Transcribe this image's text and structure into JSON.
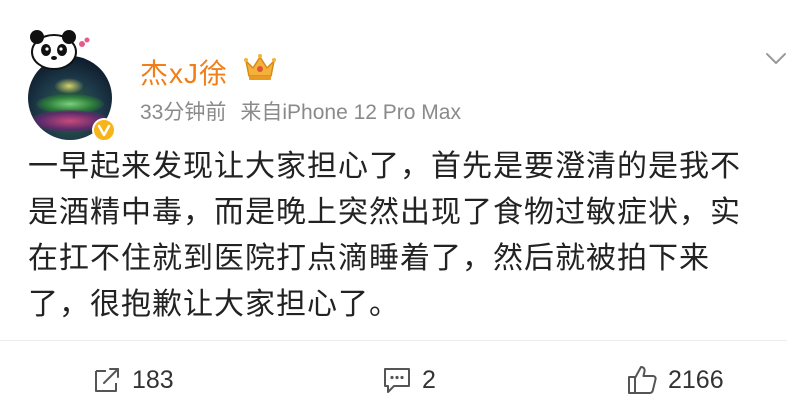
{
  "post": {
    "author": {
      "name": "杰xJ徐",
      "name_color": "#f07f1a",
      "avatar_icon": "avatar-photo",
      "badge_icon": "verified-v-icon",
      "membership_icon": "crown-icon"
    },
    "meta": {
      "time": "33分钟前",
      "source": "来自iPhone 12 Pro Max"
    },
    "text": [
      "一早起来发现让大家担心了，首先是要澄清的是我不",
      "是酒精中毒，而是晚上突然出现了食物过敏症状，实",
      "在扛不住就到医院打点滴睡着了，然后就被拍下来",
      "了，很抱歉让大家担心了。"
    ]
  },
  "actions": {
    "repost": {
      "icon": "repost-icon",
      "count": "183"
    },
    "comment": {
      "icon": "comment-icon",
      "count": "2"
    },
    "like": {
      "icon": "thumbs-up-icon",
      "count": "2166"
    }
  },
  "more_icon": "chevron-down-icon"
}
